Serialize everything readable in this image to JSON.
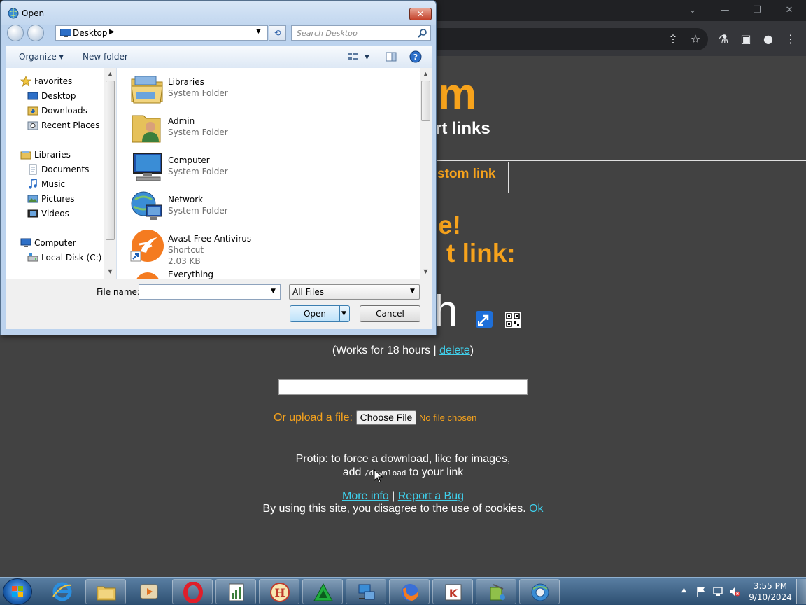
{
  "dialog": {
    "title": "Open",
    "address": {
      "location": "Desktop"
    },
    "search_placeholder": "Search Desktop",
    "toolbar": {
      "organize_label": "Organize",
      "new_folder_label": "New folder"
    },
    "nav": {
      "favorites": {
        "label": "Favorites",
        "items": [
          "Desktop",
          "Downloads",
          "Recent Places"
        ]
      },
      "libraries": {
        "label": "Libraries",
        "items": [
          "Documents",
          "Music",
          "Pictures",
          "Videos"
        ]
      },
      "computer": {
        "label": "Computer",
        "items": [
          "Local Disk (C:)"
        ]
      }
    },
    "files": [
      {
        "name": "Libraries",
        "type": "System Folder",
        "size": "",
        "icon": "libraries-folder-icon"
      },
      {
        "name": "Admin",
        "type": "System Folder",
        "size": "",
        "icon": "user-folder-icon"
      },
      {
        "name": "Computer",
        "type": "System Folder",
        "size": "",
        "icon": "computer-icon"
      },
      {
        "name": "Network",
        "type": "System Folder",
        "size": "",
        "icon": "network-icon"
      },
      {
        "name": "Avast Free Antivirus",
        "type": "Shortcut",
        "size": "2.03 KB",
        "icon": "avast-icon"
      },
      {
        "name": "Everything",
        "type": "",
        "size": "",
        "icon": "everything-icon"
      }
    ],
    "file_name_label": "File name:",
    "file_name_value": "",
    "filter_value": "All Files",
    "open_label": "Open",
    "cancel_label": "Cancel"
  },
  "page": {
    "brand_fragment": "m",
    "tagline_fragment": "rt links",
    "custom_link_fragment": "stom link",
    "headline_line1": "e!",
    "headline_line2": "t link:",
    "short_url_fragment": "h",
    "works_text": "(Works for 18 hours | ",
    "delete_label": "delete",
    "works_close": ")",
    "upload_label": "Or upload a file:",
    "choose_file_label": "Choose File",
    "no_file_text": "No file chosen",
    "protip_line1": "Protip: to force a download, like for images,",
    "protip_add": "add ",
    "protip_code": "/download",
    "protip_tail": " to your link",
    "more_info_label": "More info",
    "separator": " | ",
    "report_bug_label": "Report a Bug",
    "cookie_text": "By using this site, you disagree to the use of cookies. ",
    "ok_label": "Ok"
  },
  "taskbar": {
    "apps": [
      "internet-explorer",
      "file-explorer",
      "media-player",
      "opera",
      "notepad-chart",
      "hathitrust",
      "triangle-app",
      "network-tool",
      "firefox",
      "kaspersky",
      "paint-tool",
      "globe-app"
    ],
    "time": "3:55 PM",
    "date": "9/10/2024"
  },
  "colors": {
    "accent_orange": "#f7a31c",
    "link_cyan": "#3fd0ec",
    "page_bg": "#424242"
  }
}
